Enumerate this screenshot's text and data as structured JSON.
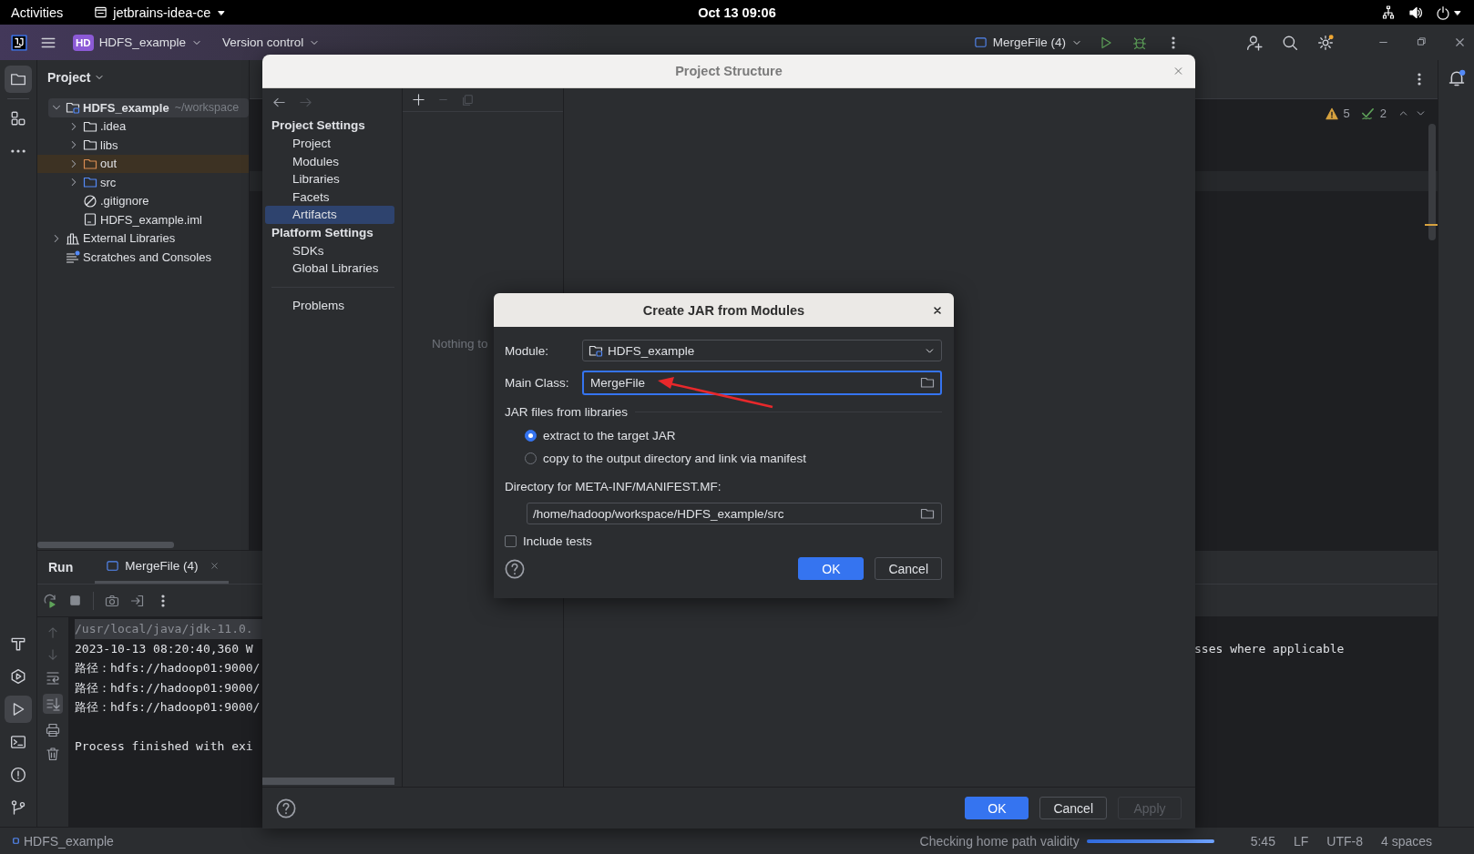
{
  "top_bar": {
    "activities": "Activities",
    "app_menu": "jetbrains-idea-ce",
    "clock": "Oct 13  09:06"
  },
  "toolbar": {
    "project_badge": "HD",
    "project": "HDFS_example",
    "vcs": "Version control",
    "run_config": "MergeFile (4)"
  },
  "tool_strip": {
    "top": [
      {
        "kind": "project",
        "selected": true
      },
      {
        "kind": "structure",
        "selected": false
      },
      {
        "kind": "more",
        "selected": false
      }
    ],
    "bottom": [
      {
        "kind": "build",
        "selected": false
      },
      {
        "kind": "services",
        "selected": false
      },
      {
        "kind": "run",
        "selected": true
      },
      {
        "kind": "terminal",
        "selected": false
      },
      {
        "kind": "problems",
        "selected": false
      },
      {
        "kind": "git",
        "selected": false
      }
    ]
  },
  "project_panel": {
    "title": "Project",
    "tree": [
      {
        "label": "HDFS_example",
        "hint": "~/workspace",
        "kind": "module",
        "expanded": true,
        "selected": true,
        "children": [
          {
            "label": ".idea",
            "kind": "folder",
            "expanded": false,
            "selected": false
          },
          {
            "label": "libs",
            "kind": "folder",
            "expanded": false,
            "selected": false
          },
          {
            "label": "out",
            "kind": "excluded",
            "expanded": false,
            "selected": false
          },
          {
            "label": "src",
            "kind": "source",
            "expanded": false,
            "selected": false
          },
          {
            "label": ".gitignore",
            "kind": "ignore",
            "selected": false
          },
          {
            "label": "HDFS_example.iml",
            "kind": "iml",
            "selected": false
          }
        ]
      },
      {
        "label": "External Libraries",
        "kind": "libraries",
        "expanded": false,
        "selected": false
      },
      {
        "label": "Scratches and Consoles",
        "kind": "scratches",
        "selected": false
      }
    ]
  },
  "editor": {
    "warnings": "5",
    "checks": "2"
  },
  "run_panel": {
    "title": "Run",
    "tabs": [
      {
        "label": "MergeFile (4)",
        "selected": true
      }
    ],
    "console": [
      {
        "text": "/usr/local/java/jdk-11.0.",
        "kind": "command"
      },
      {
        "text": "2023-10-13 08:20:40,360 W",
        "kind": "output"
      },
      {
        "text": "路径：hdfs://hadoop01:9000/",
        "kind": "output"
      },
      {
        "text": "路径：hdfs://hadoop01:9000/",
        "kind": "output"
      },
      {
        "text": "路径：hdfs://hadoop01:9000/",
        "kind": "output"
      },
      {
        "text": "Process finished with exi",
        "kind": "exit"
      }
    ],
    "console_right": "sses where applicable"
  },
  "project_structure": {
    "title": "Project Structure",
    "sections": [
      {
        "title": "Project Settings",
        "items": [
          {
            "label": "Project",
            "selected": false
          },
          {
            "label": "Modules",
            "selected": false
          },
          {
            "label": "Libraries",
            "selected": false
          },
          {
            "label": "Facets",
            "selected": false
          },
          {
            "label": "Artifacts",
            "selected": true
          }
        ]
      },
      {
        "title": "Platform Settings",
        "items": [
          {
            "label": "SDKs",
            "selected": false
          },
          {
            "label": "Global Libraries",
            "selected": false
          }
        ]
      },
      {
        "items": [
          {
            "label": "Problems",
            "selected": false
          }
        ]
      }
    ],
    "empty_text": "Nothing to",
    "buttons": [
      {
        "label": "OK",
        "kind": "primary"
      },
      {
        "label": "Cancel",
        "kind": "default"
      },
      {
        "label": "Apply",
        "kind": "disabled"
      }
    ]
  },
  "jar_dialog": {
    "title": "Create JAR from Modules",
    "module_label": "Module:",
    "module": "HDFS_example",
    "main_class_label": "Main Class:",
    "main_class": "MergeFile",
    "libraries_title": "JAR files from libraries",
    "options": [
      {
        "label": "extract to the target JAR",
        "selected": true
      },
      {
        "label": "copy to the output directory and link via manifest",
        "selected": false
      }
    ],
    "manifest_label": "Directory for META-INF/MANIFEST.MF:",
    "manifest_dir": "/home/hadoop/workspace/HDFS_example/src",
    "include_tests": {
      "label": "Include tests",
      "checked": false
    },
    "buttons": [
      {
        "label": "OK",
        "kind": "primary"
      },
      {
        "label": "Cancel",
        "kind": "default"
      }
    ]
  },
  "status_bar": {
    "project": "HDFS_example",
    "task": "Checking home path validity",
    "level": 1,
    "position": "5:45",
    "line_separator": "LF",
    "encoding": "UTF-8",
    "indent": "4 spaces"
  }
}
